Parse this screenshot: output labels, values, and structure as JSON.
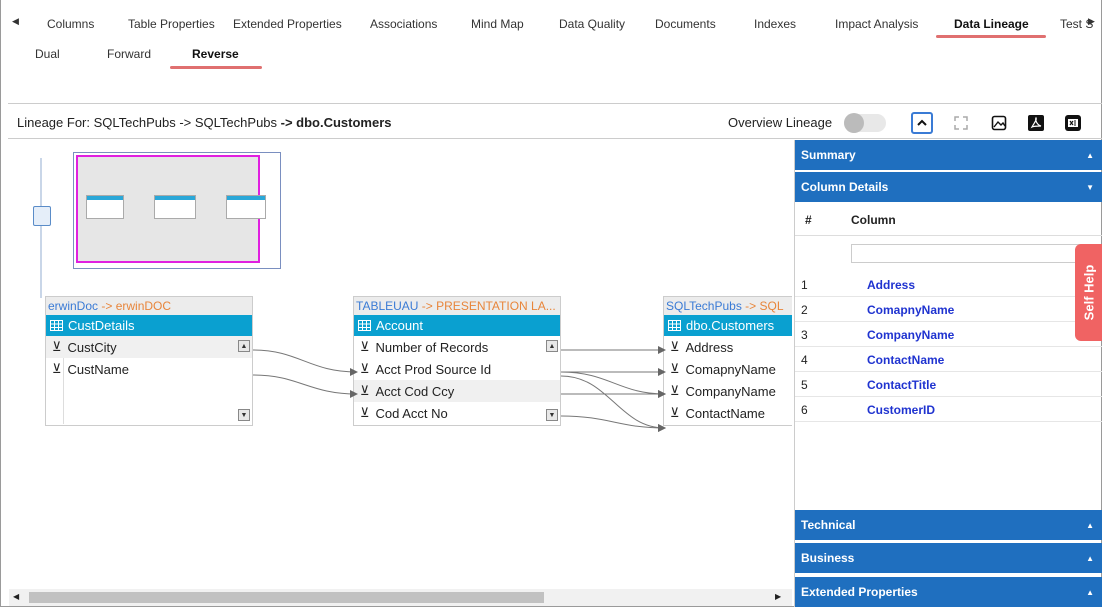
{
  "tabs": [
    {
      "label": "Columns"
    },
    {
      "label": "Table Properties"
    },
    {
      "label": "Extended Properties"
    },
    {
      "label": "Associations"
    },
    {
      "label": "Mind Map"
    },
    {
      "label": "Data Quality"
    },
    {
      "label": "Documents"
    },
    {
      "label": "Indexes"
    },
    {
      "label": "Impact Analysis"
    },
    {
      "label": "Data Lineage"
    },
    {
      "label": "Test S"
    }
  ],
  "active_tab": "Data Lineage",
  "subtabs": [
    {
      "label": "Dual"
    },
    {
      "label": "Forward"
    },
    {
      "label": "Reverse"
    }
  ],
  "active_subtab": "Reverse",
  "lineage": {
    "prefix": "Lineage For: SQLTechPubs -> SQLTechPubs ",
    "target": "-> dbo.Customers",
    "overview_label": "Overview Lineage",
    "overview_enabled": false
  },
  "entities": [
    {
      "source_db": "erwinDoc",
      "source_rest": " -> erwinDOC",
      "title": "CustDetails",
      "columns": [
        "CustCity",
        "CustName"
      ]
    },
    {
      "source_db": "TABLEUAU",
      "source_rest": " -> PRESENTATION LA...",
      "title": "Account",
      "columns": [
        "Number of Records",
        "Acct Prod Source Id",
        "Acct Cod Ccy",
        "Cod Acct No"
      ]
    },
    {
      "source_db": "SQLTechPubs",
      "source_rest": " -> SQL",
      "title": "dbo.Customers",
      "columns": [
        "Address",
        "ComapnyName",
        "CompanyName",
        "ContactName"
      ]
    }
  ],
  "panel": {
    "summary": "Summary",
    "column_details": "Column Details",
    "col_header_num": "#",
    "col_header_name": "Column",
    "columns": [
      {
        "n": "1",
        "name": "Address"
      },
      {
        "n": "2",
        "name": "ComapnyName"
      },
      {
        "n": "3",
        "name": "CompanyName"
      },
      {
        "n": "4",
        "name": "ContactName"
      },
      {
        "n": "5",
        "name": "ContactTitle"
      },
      {
        "n": "6",
        "name": "CustomerID"
      }
    ],
    "technical": "Technical",
    "business": "Business",
    "extended": "Extended Properties"
  },
  "self_help": "Self Help",
  "colors": {
    "accordion": "#1f6fbf",
    "entity_header": "#0aa0d0",
    "active_underline": "#e07070",
    "minimap_viewport": "#e020e0",
    "self_help": "#f06363"
  }
}
